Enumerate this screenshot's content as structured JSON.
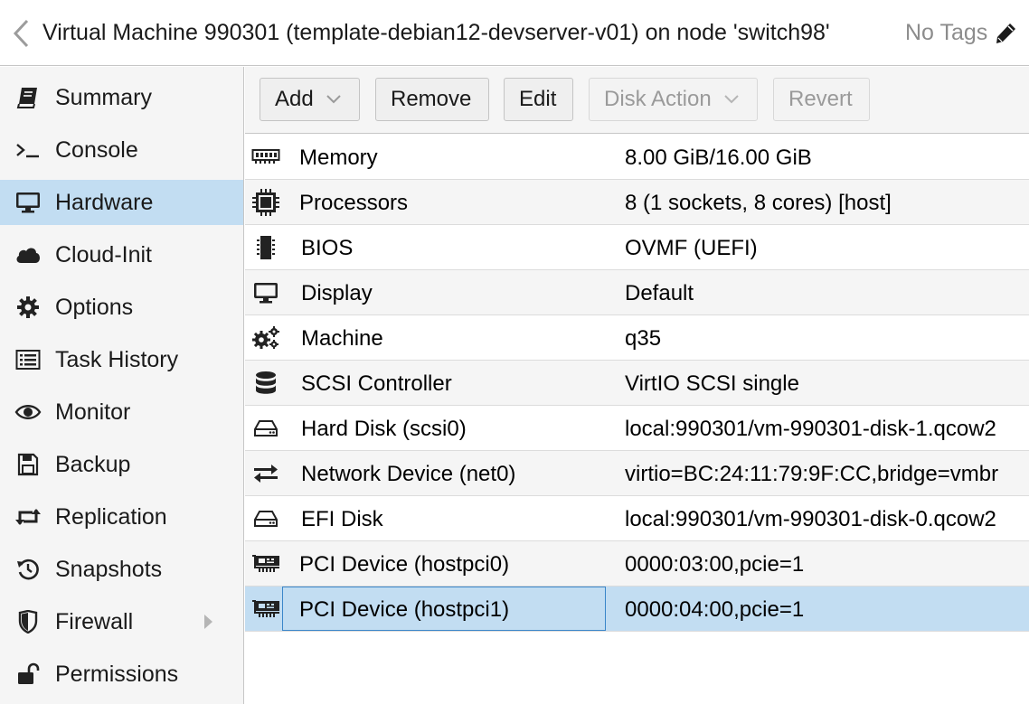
{
  "header": {
    "title": "Virtual Machine 990301 (template-debian12-devserver-v01) on node 'switch98'",
    "tags": "No Tags"
  },
  "sidebar": {
    "items": [
      {
        "label": "Summary",
        "icon": "book-icon"
      },
      {
        "label": "Console",
        "icon": "terminal-icon"
      },
      {
        "label": "Hardware",
        "icon": "monitor-icon",
        "selected": true
      },
      {
        "label": "Cloud-Init",
        "icon": "cloud-icon"
      },
      {
        "label": "Options",
        "icon": "gear-icon"
      },
      {
        "label": "Task History",
        "icon": "list-icon"
      },
      {
        "label": "Monitor",
        "icon": "eye-icon"
      },
      {
        "label": "Backup",
        "icon": "floppy-icon"
      },
      {
        "label": "Replication",
        "icon": "retweet-icon"
      },
      {
        "label": "Snapshots",
        "icon": "history-icon"
      },
      {
        "label": "Firewall",
        "icon": "shield-icon",
        "expandable": true
      },
      {
        "label": "Permissions",
        "icon": "unlock-icon"
      }
    ]
  },
  "toolbar": {
    "add": "Add",
    "remove": "Remove",
    "edit": "Edit",
    "disk_action": "Disk Action",
    "revert": "Revert"
  },
  "hardware": {
    "rows": [
      {
        "key": "Memory",
        "value": "8.00 GiB/16.00 GiB",
        "icon": "memory-icon"
      },
      {
        "key": "Processors",
        "value": "8 (1 sockets, 8 cores) [host]",
        "icon": "cpu-icon"
      },
      {
        "key": "BIOS",
        "value": "OVMF (UEFI)",
        "icon": "microchip-icon"
      },
      {
        "key": "Display",
        "value": "Default",
        "icon": "display-icon"
      },
      {
        "key": "Machine",
        "value": "q35",
        "icon": "cogs-icon"
      },
      {
        "key": "SCSI Controller",
        "value": "VirtIO SCSI single",
        "icon": "database-icon"
      },
      {
        "key": "Hard Disk (scsi0)",
        "value": "local:990301/vm-990301-disk-1.qcow2",
        "icon": "hdd-icon"
      },
      {
        "key": "Network Device (net0)",
        "value": "virtio=BC:24:11:79:9F:CC,bridge=vmbr",
        "icon": "exchange-icon"
      },
      {
        "key": "EFI Disk",
        "value": "local:990301/vm-990301-disk-0.qcow2",
        "icon": "hdd-icon"
      },
      {
        "key": "PCI Device (hostpci0)",
        "value": "0000:03:00,pcie=1",
        "icon": "pci-card-icon"
      },
      {
        "key": "PCI Device (hostpci1)",
        "value": "0000:04:00,pcie=1",
        "icon": "pci-card-icon",
        "selected": true
      }
    ]
  },
  "colors": {
    "selected": "#c2ddf2",
    "focus_border": "#3a86c9",
    "sidebar_bg": "#f5f5f5",
    "disabled_text": "#9a9a9a"
  }
}
